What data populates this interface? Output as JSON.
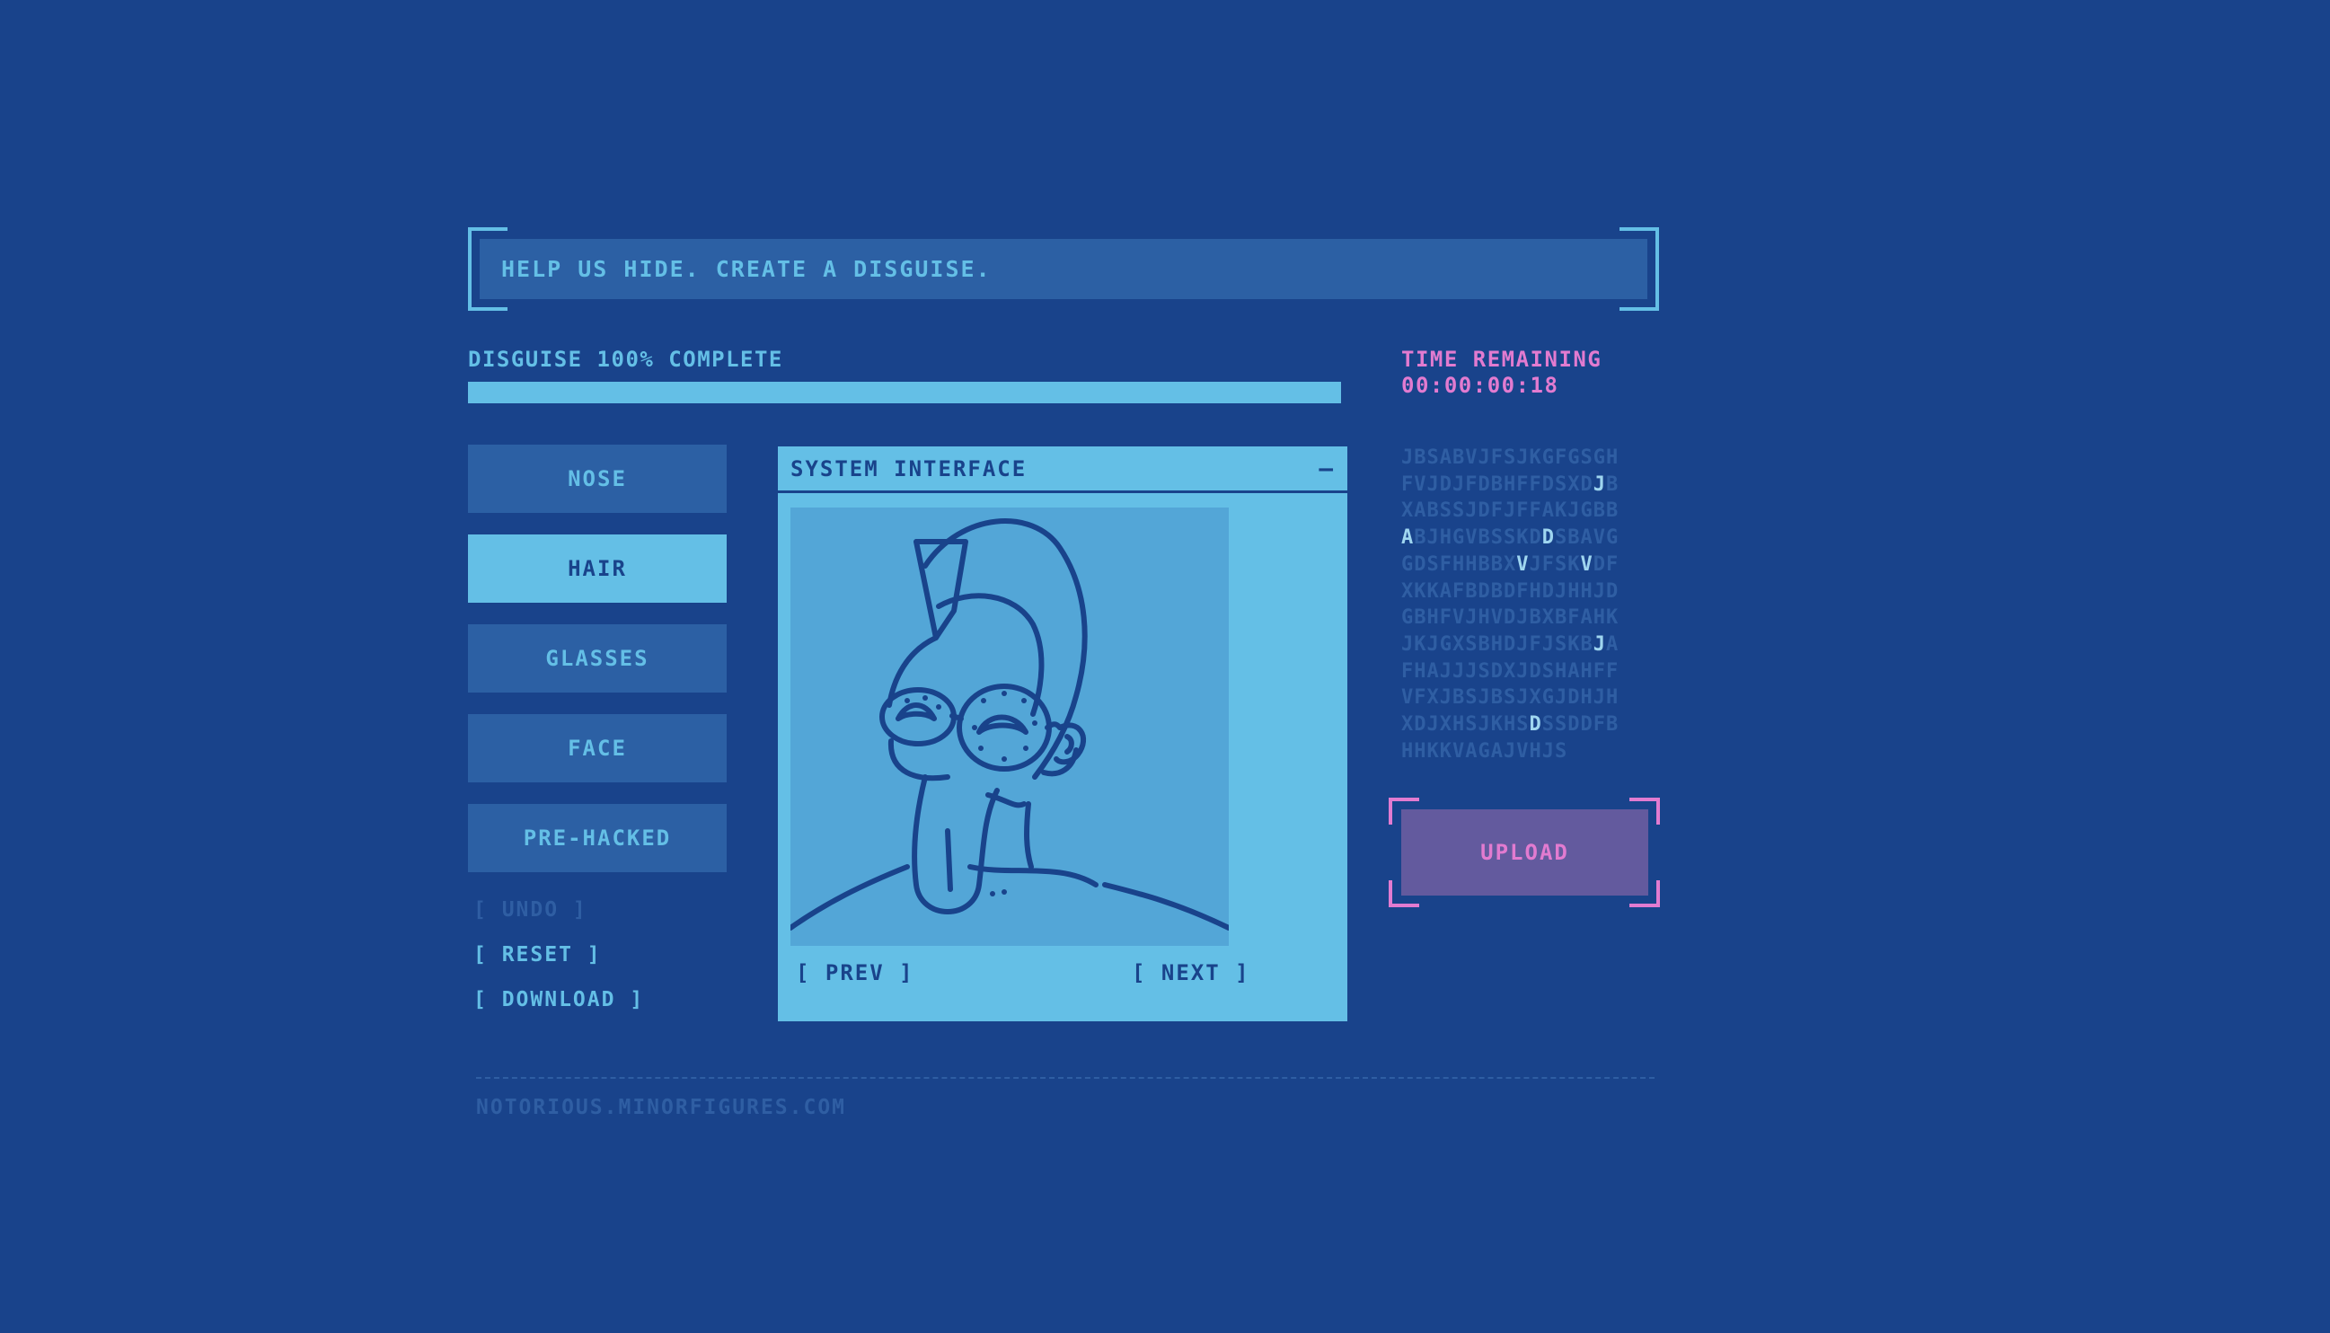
{
  "header": {
    "banner_text": "HELP US HIDE. CREATE A DISGUISE."
  },
  "progress": {
    "label": "DISGUISE 100% COMPLETE",
    "percent": 100
  },
  "timer": {
    "label": "TIME REMAINING",
    "value": "00:00:00:18"
  },
  "categories": [
    {
      "label": "NOSE",
      "active": false
    },
    {
      "label": "HAIR",
      "active": true
    },
    {
      "label": "GLASSES",
      "active": false
    },
    {
      "label": "FACE",
      "active": false
    },
    {
      "label": "PRE-HACKED",
      "active": false
    }
  ],
  "actions": {
    "undo": "[ UNDO ]",
    "reset": "[ RESET ]",
    "download": "[ DOWNLOAD ]"
  },
  "window": {
    "title": "SYSTEM INTERFACE",
    "minimize": "–",
    "prev": "[ PREV ]",
    "next": "[ NEXT ]"
  },
  "code_lines": [
    "JBSABVJFSJKGFGSGH",
    "FVJDJFDBHFFDSXDJB",
    "XABSSJDFJFFAKJGBB",
    "ABJHGVBSSKDDSBAVG",
    "GDSFHHBBXVJFSKVDF",
    "XKKAFBDBDFHDJHHJD",
    "GBHFVJHVDJBXBFAHK",
    "JKJGXSBHDJFJSKBJA",
    "FHAJJJSDXJDSHAHFF",
    "VFXJBSJBSJXGJDHJH",
    "XDJXHSJKHSDSSDDFB",
    "HHKKVAGAJVHJS"
  ],
  "upload": {
    "label": "UPLOAD"
  },
  "footer": {
    "url": "NOTORIOUS.MINORFIGURES.COM"
  },
  "colors": {
    "background": "#19438b",
    "panel": "#2c60a4",
    "accent": "#64bfe6",
    "pink": "#e27bd0",
    "upload_bg": "#635a9e"
  }
}
